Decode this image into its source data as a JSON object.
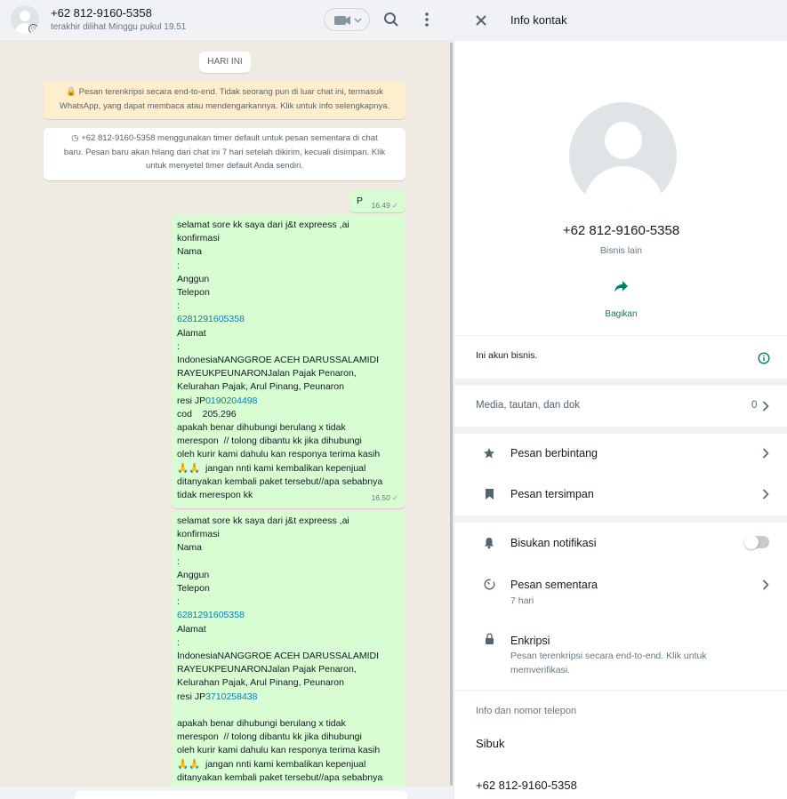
{
  "chat": {
    "contact_name": "+62 812-9160-5358",
    "status": "terakhir dilihat Minggu pukul 19.51",
    "day_chip": "HARI INI",
    "encryption_notice": {
      "icon": "lock-icon",
      "lines": [
        "Pesan terenkripsi secara end-to-end. Tidak seorang pun di luar chat ini, termasuk",
        "WhatsApp, yang dapat membaca atau mendengarkannya. Klik untuk info selengkapnya."
      ]
    },
    "timer_notice": {
      "icon": "timer-icon",
      "lines": [
        "+62 812-9160-5358 menggunakan timer default untuk pesan sementara di chat",
        "baru. Pesan baru akan hilang dari chat ini 7 hari setelah dikirim, kecuali disimpan. Klik",
        "untuk menyetel timer default Anda sendiri."
      ]
    },
    "messages": [
      {
        "lines": [
          "P"
        ],
        "time": "16.49"
      },
      {
        "lines": [
          "selamat sore kk saya dari j&t expreess ,ai",
          "konfirmasi",
          "Nama",
          ":",
          "Anggun",
          "Telepon",
          ":",
          "6281291605358",
          "Alamat",
          ":",
          "IndonesiaNANGGROE ACEH DARUSSALAMIDI",
          "RAYEUKPEUNARONJalan Pajak Penaron,",
          "Kelurahan Pajak, Arul Pinang, Peunaron",
          "resi JP0190204498",
          "cod    205.296",
          "apakah benar dihubungi berulang x tidak",
          "merespon  // tolong dibantu kk jika dihubungi",
          "oleh kurir kami dahulu kan responya terima kasih",
          "🙏🙏  jangan nnti kami kembalikan kepenjual",
          "ditanyakan kembali paket tersebut//apa sebabnya",
          "tidak merespon kk"
        ],
        "time": "16.50"
      },
      {
        "lines": [
          "selamat sore kk saya dari j&t expreess ,ai",
          "konfirmasi",
          "Nama",
          ":",
          "Anggun",
          "Telepon",
          ":",
          "6281291605358",
          "Alamat",
          ":",
          "IndonesiaNANGGROE ACEH DARUSSALAMIDI",
          "RAYEUKPEUNARONJalan Pajak Penaron,",
          "Kelurahan Pajak, Arul Pinang, Peunaron",
          "resi JP3710258438",
          "",
          "apakah benar dihubungi berulang x tidak",
          "merespon  // tolong dibantu kk jika dihubungi",
          "oleh kurir kami dahulu kan responya terima kasih",
          "🙏🙏  jangan nnti kami kembalikan kepenjual",
          "ditanyakan kembali paket tersebut//apa sebabnya"
        ]
      }
    ]
  },
  "info": {
    "title": "Info kontak",
    "name": "+62 812-9160-5358",
    "subtitle": "Bisnis lain",
    "share_label": "Bagikan",
    "business_note": "Ini akun bisnis.",
    "media_label": "Media, tautan, dan dok",
    "media_count": "0",
    "starred": "Pesan berbintang",
    "saved": "Pesan tersimpan",
    "mute": "Bisukan notifikasi",
    "mute_on": false,
    "disappearing": "Pesan sementara",
    "disappearing_value": "7 hari",
    "encryption": "Enkripsi",
    "encryption_desc_1": "Pesan terenkripsi secara end-to-end. Klik untuk",
    "encryption_desc_2": "memverifikasi.",
    "about_header": "Info dan nomor telepon",
    "about": "Sibuk",
    "phone": "+62 812-9160-5358"
  },
  "colors": {
    "accent": "#008069",
    "bubble_out": "#d9fdd3",
    "link": "#027eb5"
  }
}
